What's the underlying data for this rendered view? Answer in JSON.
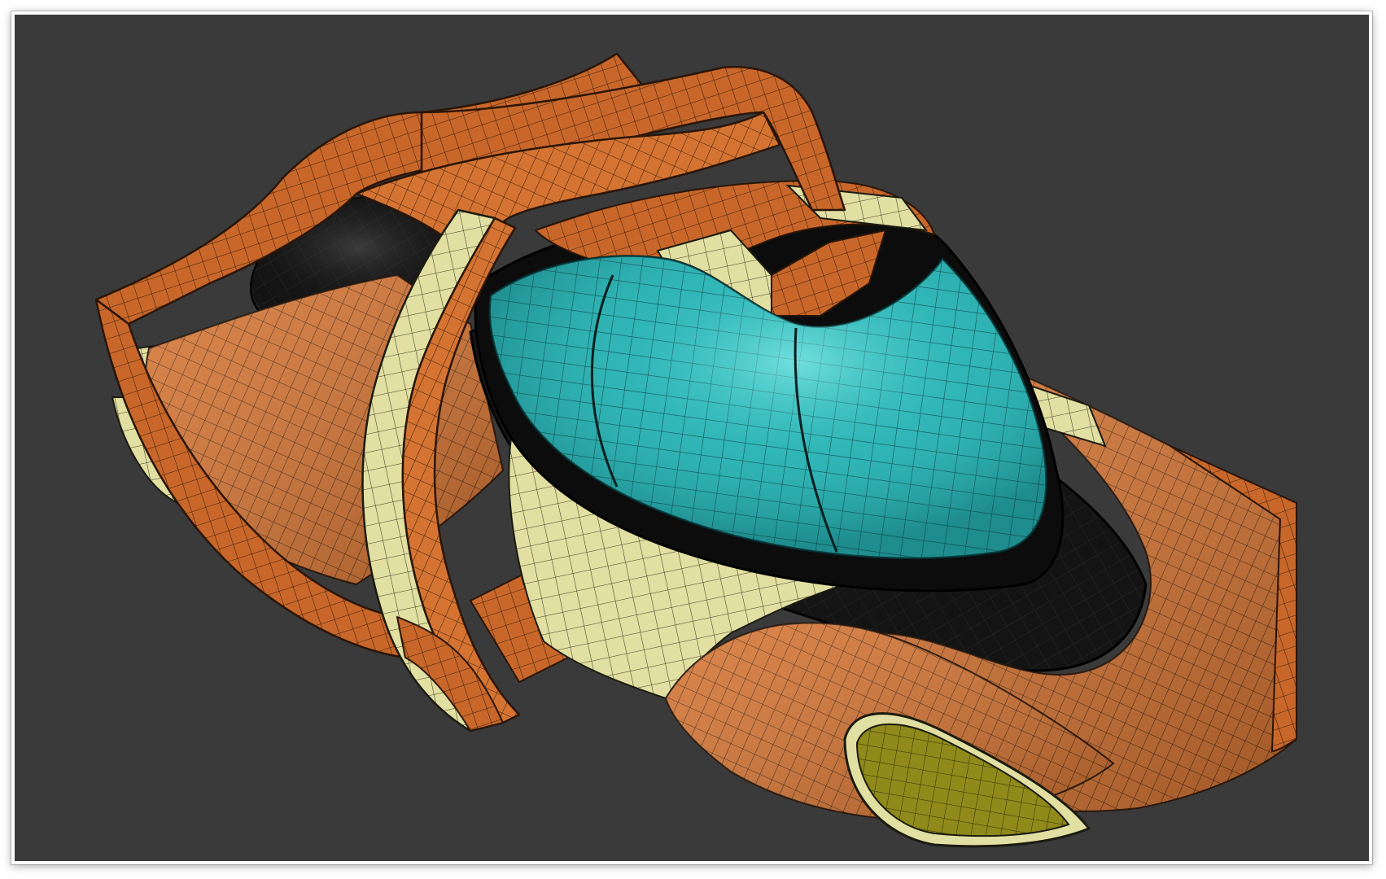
{
  "viewport": {
    "background_color": "#3a3a3a",
    "shading": "smooth-with-mesh-edges"
  },
  "model": {
    "parts": [
      {
        "name": "roll-cage-frame",
        "color": "#c9672a"
      },
      {
        "name": "canopy",
        "color": "#2fb7b8"
      },
      {
        "name": "canopy-seal",
        "color": "#111111"
      },
      {
        "name": "hull-panels",
        "color": "#c9672a"
      },
      {
        "name": "accent-panels",
        "color": "#dedc9a"
      },
      {
        "name": "intake",
        "color": "#8f8a1a"
      },
      {
        "name": "rear-engine-interior",
        "color": "#151515"
      }
    ]
  }
}
